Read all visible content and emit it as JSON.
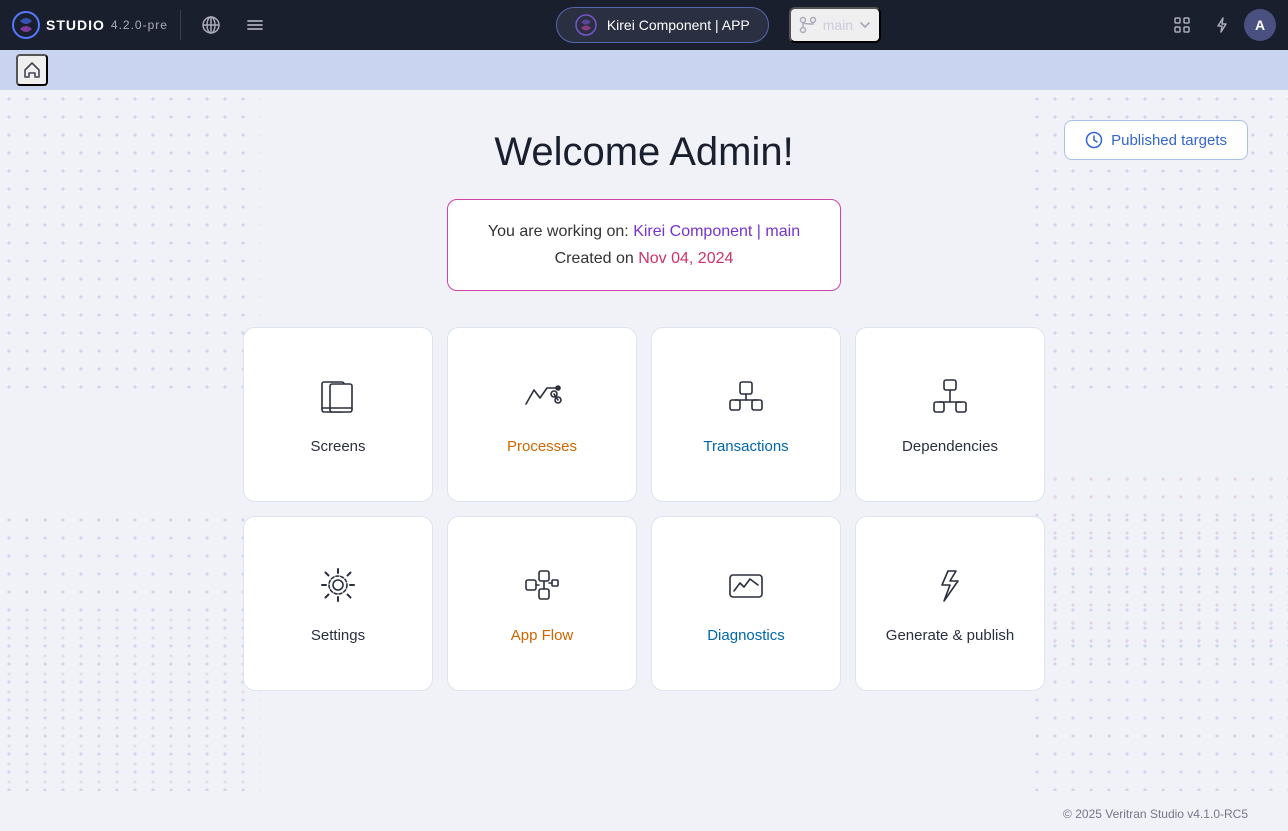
{
  "topnav": {
    "studio_label": "STUDIO",
    "version": "4.2.0-pre",
    "project_label": "Kirei Component | APP",
    "branch_label": "main",
    "avatar_label": "A"
  },
  "secondnav": {
    "home_icon": "🏠"
  },
  "main": {
    "published_targets_label": "Published targets",
    "welcome_title": "Welcome Admin!",
    "working_on_prefix": "You are working on: ",
    "working_on_project": "Kirei Component | main",
    "created_on_prefix": "Created on ",
    "created_on_date": "Nov 04, 2024",
    "cards": [
      {
        "id": "screens",
        "label": "Screens",
        "style": "normal"
      },
      {
        "id": "processes",
        "label": "Processes",
        "style": "highlighted"
      },
      {
        "id": "transactions",
        "label": "Transactions",
        "style": "highlighted-teal"
      },
      {
        "id": "dependencies",
        "label": "Dependencies",
        "style": "normal"
      },
      {
        "id": "settings",
        "label": "Settings",
        "style": "normal"
      },
      {
        "id": "app-flow",
        "label": "App Flow",
        "style": "highlighted"
      },
      {
        "id": "diagnostics",
        "label": "Diagnostics",
        "style": "highlighted-teal"
      },
      {
        "id": "generate-publish",
        "label": "Generate & publish",
        "style": "normal"
      }
    ]
  },
  "footer": {
    "copyright": "© 2025 Veritran Studio v4.1.0-RC5"
  }
}
